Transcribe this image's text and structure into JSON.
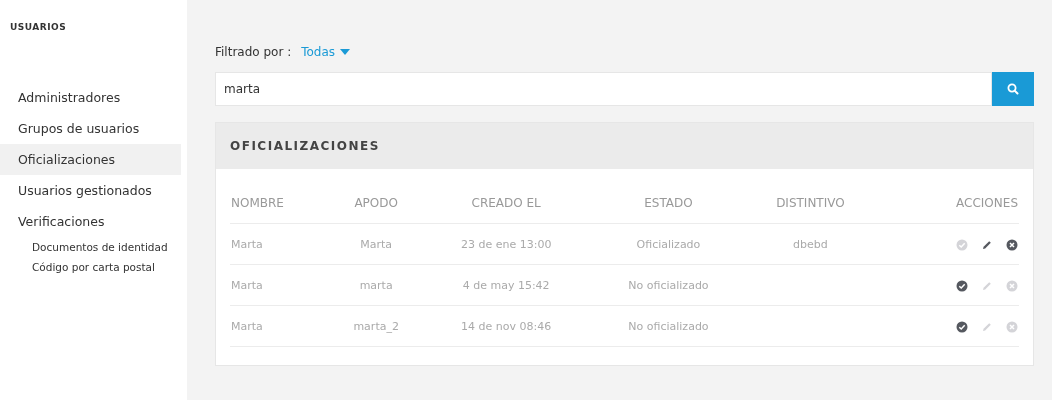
{
  "sidebar": {
    "title": "USUARIOS",
    "items": [
      {
        "label": "Administradores",
        "selected": false
      },
      {
        "label": "Grupos de usuarios",
        "selected": false
      },
      {
        "label": "Oficializaciones",
        "selected": true
      },
      {
        "label": "Usuarios gestionados",
        "selected": false
      },
      {
        "label": "Verificaciones",
        "selected": false,
        "children": [
          {
            "label": "Documentos de identidad",
            "selected": false
          },
          {
            "label": "Código por carta postal",
            "selected": false
          }
        ]
      }
    ]
  },
  "filter": {
    "label": "Filtrado por :",
    "value": "Todas"
  },
  "search": {
    "value": "marta"
  },
  "panel": {
    "title": "OFICIALIZACIONES",
    "columns": [
      "NOMBRE",
      "APODO",
      "CREADO EL",
      "ESTADO",
      "DISTINTIVO",
      "ACCIONES"
    ],
    "rows": [
      {
        "cells": [
          "Marta",
          "Marta",
          "23 de ene 13:00",
          "Oficializado",
          "dbebd"
        ],
        "actions": [
          {
            "kind": "approve",
            "disabled": true
          },
          {
            "kind": "edit",
            "disabled": false
          },
          {
            "kind": "reject",
            "disabled": false
          }
        ]
      },
      {
        "cells": [
          "Marta",
          "marta",
          "4 de may 15:42",
          "No oficializado",
          ""
        ],
        "actions": [
          {
            "kind": "approve",
            "disabled": false
          },
          {
            "kind": "edit",
            "disabled": true
          },
          {
            "kind": "reject",
            "disabled": true
          }
        ]
      },
      {
        "cells": [
          "Marta",
          "marta_2",
          "14 de nov 08:46",
          "No oficializado",
          ""
        ],
        "actions": [
          {
            "kind": "approve",
            "disabled": false
          },
          {
            "kind": "edit",
            "disabled": true
          },
          {
            "kind": "reject",
            "disabled": true
          }
        ]
      }
    ]
  }
}
